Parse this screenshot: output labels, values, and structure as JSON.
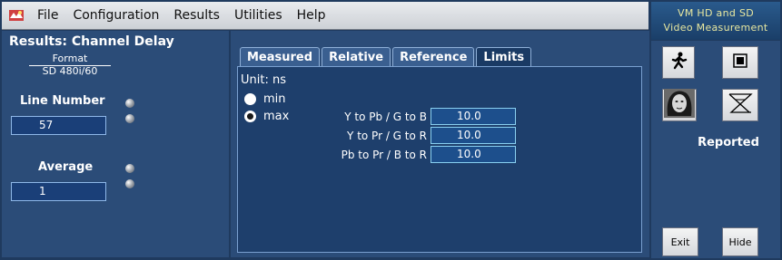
{
  "menu": {
    "items": [
      "File",
      "Configuration",
      "Results",
      "Utilities",
      "Help"
    ]
  },
  "app": {
    "title_line1": "VM HD and SD",
    "title_line2": "Video Measurement"
  },
  "left": {
    "title": "Results: Channel Delay",
    "format_label": "Format",
    "format_value": "SD 480i/60",
    "line_number_label": "Line Number",
    "line_number_value": "57",
    "average_label": "Average",
    "average_value": "1"
  },
  "tabs": [
    "Measured",
    "Relative",
    "Reference",
    "Limits"
  ],
  "active_tab": "Limits",
  "limits": {
    "unit": "Unit: ns",
    "options": [
      {
        "label": "min",
        "selected": false
      },
      {
        "label": "max",
        "selected": true
      }
    ],
    "rows": [
      {
        "label": "Y to Pb / G to B",
        "value": "10.0"
      },
      {
        "label": "Y to Pr / G to R",
        "value": "10.0"
      },
      {
        "label": "Pb to Pr / B to R",
        "value": "10.0"
      }
    ]
  },
  "right": {
    "reported": "Reported",
    "exit": "Exit",
    "hide": "Hide"
  },
  "colors": {
    "panel_bg": "#2b4c78",
    "value_border": "#8ad0f0",
    "title_text": "#e8e8a0"
  }
}
